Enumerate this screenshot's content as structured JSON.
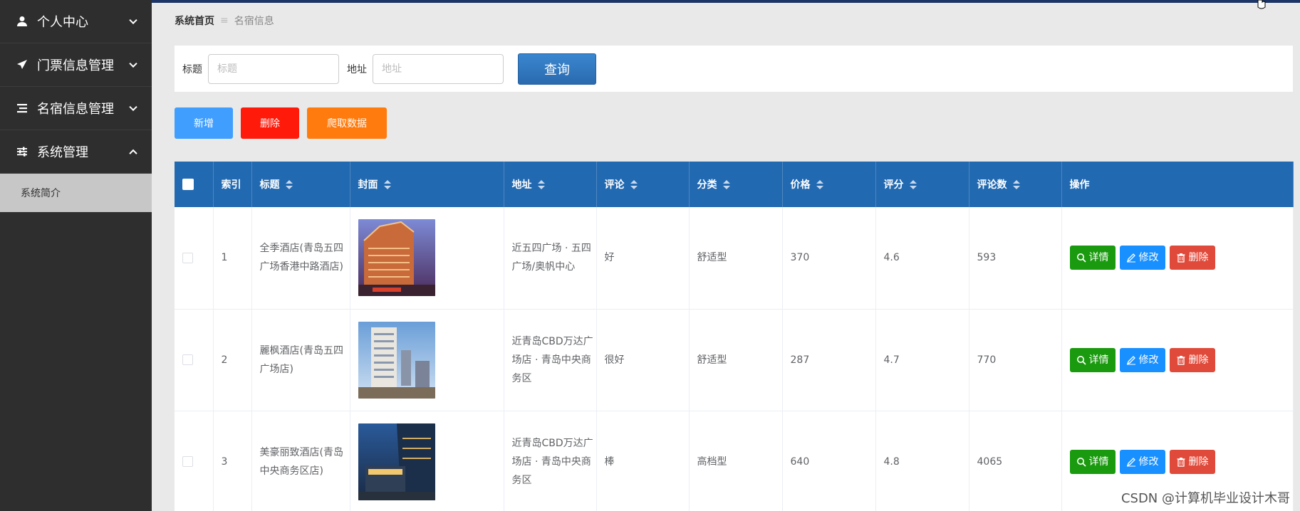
{
  "sidebar": {
    "items": [
      {
        "label": "个人中心",
        "icon": "user-icon",
        "expanded": false
      },
      {
        "label": "门票信息管理",
        "icon": "paper-plane-icon",
        "expanded": false
      },
      {
        "label": "名宿信息管理",
        "icon": "list-icon",
        "expanded": false
      },
      {
        "label": "系统管理",
        "icon": "sliders-icon",
        "expanded": true
      }
    ],
    "sub_items": [
      {
        "label": "系统简介"
      }
    ]
  },
  "breadcrumb": {
    "home": "系统首页",
    "separator": "≡",
    "current": "名宿信息"
  },
  "search": {
    "title_label": "标题",
    "title_placeholder": "标题",
    "title_value": "",
    "address_label": "地址",
    "address_placeholder": "地址",
    "address_value": "",
    "query_button": "查询"
  },
  "actions": {
    "add": "新增",
    "delete": "删除",
    "crawl": "爬取数据"
  },
  "table": {
    "columns": [
      "索引",
      "标题",
      "封面",
      "地址",
      "评论",
      "分类",
      "价格",
      "评分",
      "评论数",
      "操作"
    ],
    "rows": [
      {
        "index": "1",
        "title": "全季酒店(青岛五四广场香港中路酒店)",
        "address": "近五四广场 · 五四广场/奥帆中心",
        "comment": "好",
        "category": "舒适型",
        "price": "370",
        "rating": "4.6",
        "review_count": "593"
      },
      {
        "index": "2",
        "title": "麗枫酒店(青岛五四广场店)",
        "address": "近青岛CBD万达广场店 · 青岛中央商务区",
        "comment": "很好",
        "category": "舒适型",
        "price": "287",
        "rating": "4.7",
        "review_count": "770"
      },
      {
        "index": "3",
        "title": "美豪丽致酒店(青岛中央商务区店)",
        "address": "近青岛CBD万达广场店 · 青岛中央商务区",
        "comment": "棒",
        "category": "高档型",
        "price": "640",
        "rating": "4.8",
        "review_count": "4065"
      }
    ],
    "op_labels": {
      "detail": "详情",
      "edit": "修改",
      "delete": "删除"
    }
  },
  "watermark": "CSDN @计算机毕业设计木哥",
  "colors": {
    "sidebar_bg": "#2e2e2e",
    "header_blue": "#2169b1",
    "add": "#409eff",
    "delete": "#ff1a0a",
    "crawl": "#ff7b0d",
    "detail": "#1a9a0e",
    "edit": "#1890ff",
    "row_delete": "#e04a3a"
  }
}
